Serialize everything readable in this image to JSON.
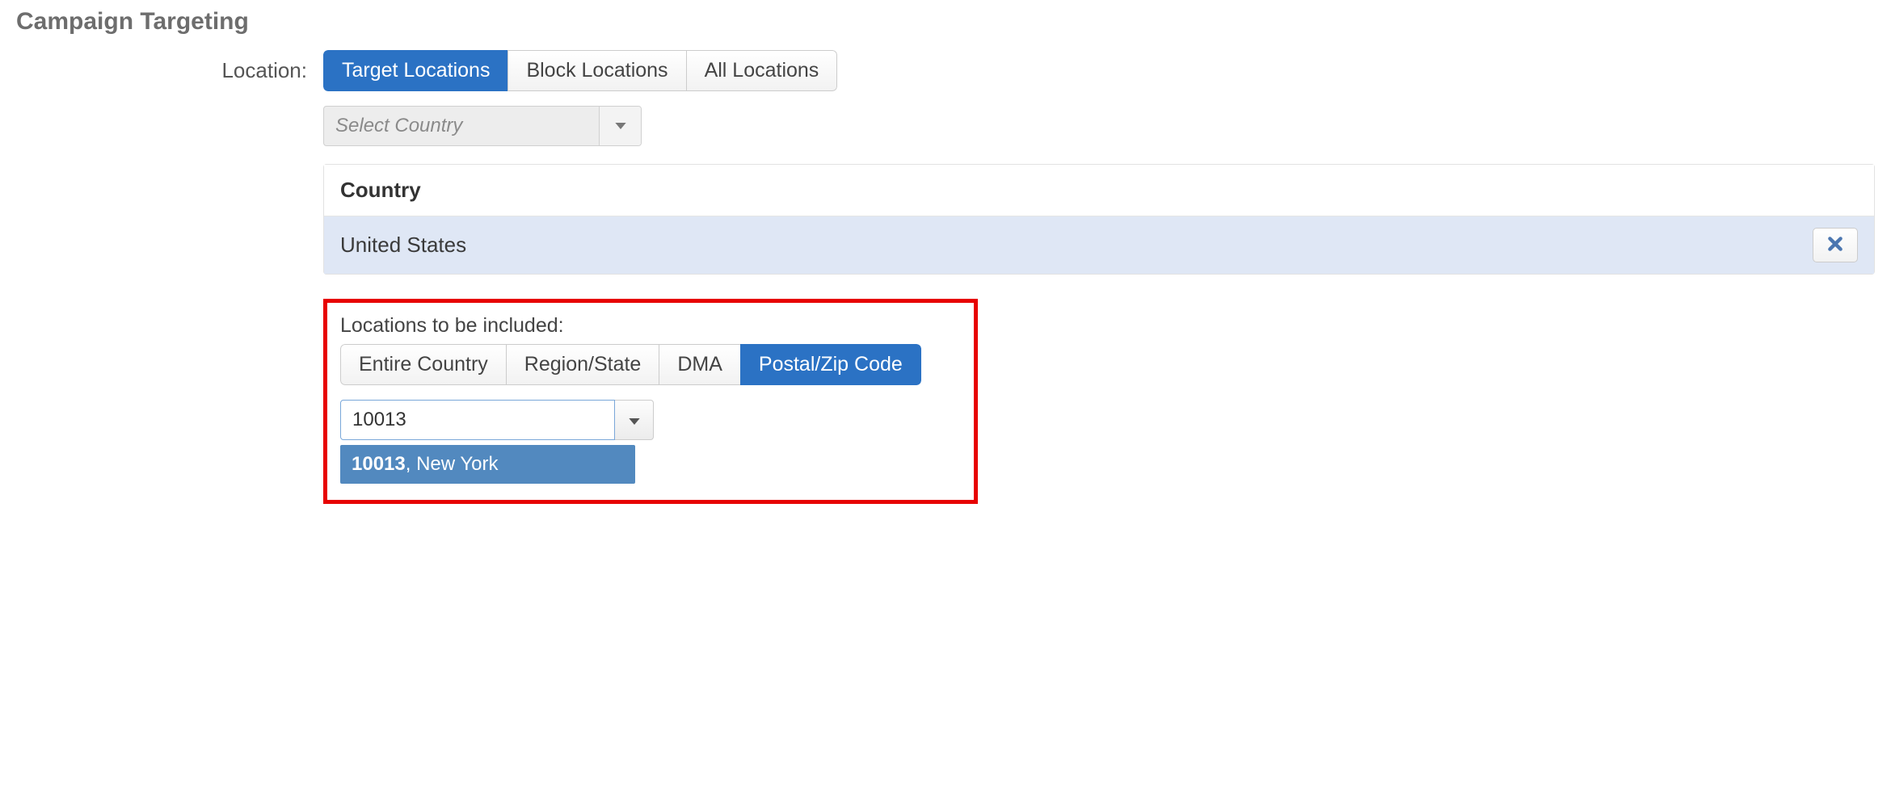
{
  "section": {
    "title": "Campaign Targeting"
  },
  "location": {
    "label": "Location:",
    "tabs": {
      "target": "Target Locations",
      "block": "Block Locations",
      "all": "All Locations"
    },
    "country_select": {
      "placeholder": "Select Country"
    },
    "panel": {
      "header": "Country",
      "rows": [
        {
          "name": "United States"
        }
      ]
    },
    "included": {
      "label": "Locations to be included:",
      "granularity": {
        "entire": "Entire Country",
        "region": "Region/State",
        "dma": "DMA",
        "postal": "Postal/Zip Code"
      },
      "zip_input": {
        "value": "10013"
      },
      "suggestion": {
        "code": "10013",
        "rest": ", New York"
      }
    }
  }
}
